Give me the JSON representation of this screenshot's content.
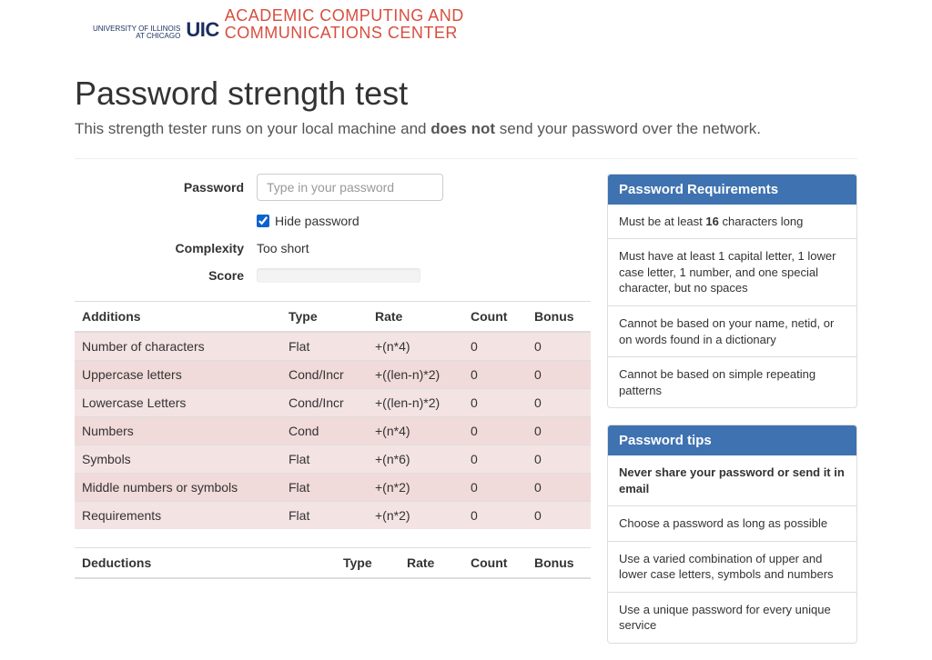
{
  "logo": {
    "uic": "UIC",
    "sub1": "UNIVERSITY OF ILLINOIS",
    "sub2": "AT CHICAGO",
    "accc_line1": "ACADEMIC COMPUTING AND",
    "accc_line2": "COMMUNICATIONS CENTER"
  },
  "page": {
    "title": "Password strength test",
    "subtitle_pre": "This strength tester runs on your local machine and ",
    "subtitle_bold": "does not",
    "subtitle_post": " send your password over the network."
  },
  "form": {
    "password_label": "Password",
    "password_placeholder": "Type in your password",
    "hide_label": "Hide password",
    "hide_checked": true,
    "complexity_label": "Complexity",
    "complexity_value": "Too short",
    "score_label": "Score"
  },
  "additions": {
    "title": "Additions",
    "headers": {
      "type": "Type",
      "rate": "Rate",
      "count": "Count",
      "bonus": "Bonus"
    },
    "rows": [
      {
        "name": "Number of characters",
        "type": "Flat",
        "rate": "+(n*4)",
        "count": "0",
        "bonus": "0"
      },
      {
        "name": "Uppercase letters",
        "type": "Cond/Incr",
        "rate": "+((len-n)*2)",
        "count": "0",
        "bonus": "0"
      },
      {
        "name": "Lowercase Letters",
        "type": "Cond/Incr",
        "rate": "+((len-n)*2)",
        "count": "0",
        "bonus": "0"
      },
      {
        "name": "Numbers",
        "type": "Cond",
        "rate": "+(n*4)",
        "count": "0",
        "bonus": "0"
      },
      {
        "name": "Symbols",
        "type": "Flat",
        "rate": "+(n*6)",
        "count": "0",
        "bonus": "0"
      },
      {
        "name": "Middle numbers or symbols",
        "type": "Flat",
        "rate": "+(n*2)",
        "count": "0",
        "bonus": "0"
      },
      {
        "name": "Requirements",
        "type": "Flat",
        "rate": "+(n*2)",
        "count": "0",
        "bonus": "0"
      }
    ]
  },
  "deductions": {
    "title": "Deductions",
    "headers": {
      "type": "Type",
      "rate": "Rate",
      "count": "Count",
      "bonus": "Bonus"
    }
  },
  "requirements": {
    "title": "Password Requirements",
    "items": [
      {
        "pre": "Must be at least ",
        "bold": "16",
        "post": " characters long"
      },
      {
        "pre": "Must have at least 1 capital letter, 1 lower case letter, 1 number, and one special character, but no spaces",
        "bold": "",
        "post": ""
      },
      {
        "pre": "Cannot be based on your name, netid, or on words found in a dictionary",
        "bold": "",
        "post": ""
      },
      {
        "pre": "Cannot be based on simple repeating patterns",
        "bold": "",
        "post": ""
      }
    ]
  },
  "tips": {
    "title": "Password tips",
    "items": [
      {
        "bold": "Never share your password or send it in email",
        "text": ""
      },
      {
        "bold": "",
        "text": "Choose a password as long as possible"
      },
      {
        "bold": "",
        "text": "Use a varied combination of upper and lower case letters, symbols and numbers"
      },
      {
        "bold": "",
        "text": "Use a unique password for every unique service"
      }
    ]
  }
}
